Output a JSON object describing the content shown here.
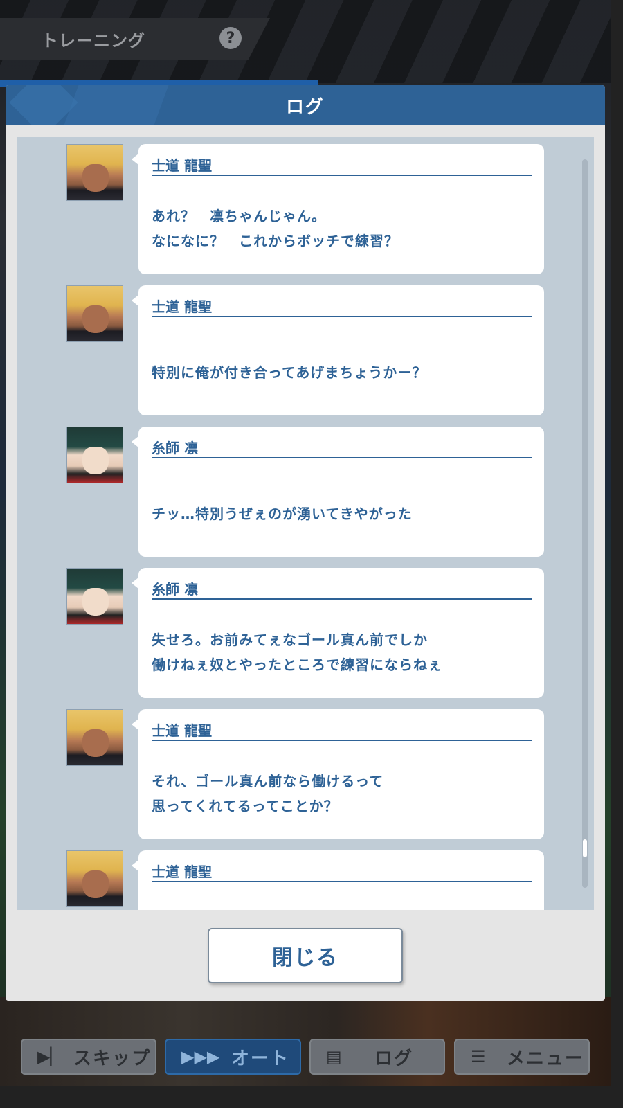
{
  "top_title": {
    "label": "トレーニング",
    "help": "?"
  },
  "modal": {
    "title": "ログ",
    "close_label": "閉じる"
  },
  "log": [
    {
      "speaker": "士道 龍聖",
      "avatar": "shidou",
      "lines": [
        "あれ？　凛ちゃんじゃん。",
        "なになに？　これからボッチで練習？"
      ]
    },
    {
      "speaker": "士道 龍聖",
      "avatar": "shidou",
      "lines": [
        "特別に俺が付き合ってあげまちょうかー？"
      ]
    },
    {
      "speaker": "糸師 凛",
      "avatar": "rin",
      "lines": [
        "チッ…特別うぜぇのが湧いてきやがった"
      ]
    },
    {
      "speaker": "糸師 凛",
      "avatar": "rin",
      "lines": [
        "失せろ。お前みてぇなゴール真ん前でしか",
        "働けねぇ奴とやったところで練習にならねぇ"
      ]
    },
    {
      "speaker": "士道 龍聖",
      "avatar": "shidou",
      "lines": [
        "それ、ゴール真ん前なら働けるって",
        "思ってくれてるってことか？"
      ]
    },
    {
      "speaker": "士道 龍聖",
      "avatar": "shidou",
      "lines": []
    }
  ],
  "bottom_bar": {
    "skip": {
      "label": "スキップ",
      "icon": "skip-icon"
    },
    "auto": {
      "label": "オート",
      "icon": "fast-forward-icon"
    },
    "log": {
      "label": "ログ",
      "icon": "document-icon"
    },
    "menu": {
      "label": "メニュー",
      "icon": "hamburger-icon"
    }
  },
  "colors": {
    "accent": "#2e6296",
    "panel": "#c0ccd6"
  }
}
